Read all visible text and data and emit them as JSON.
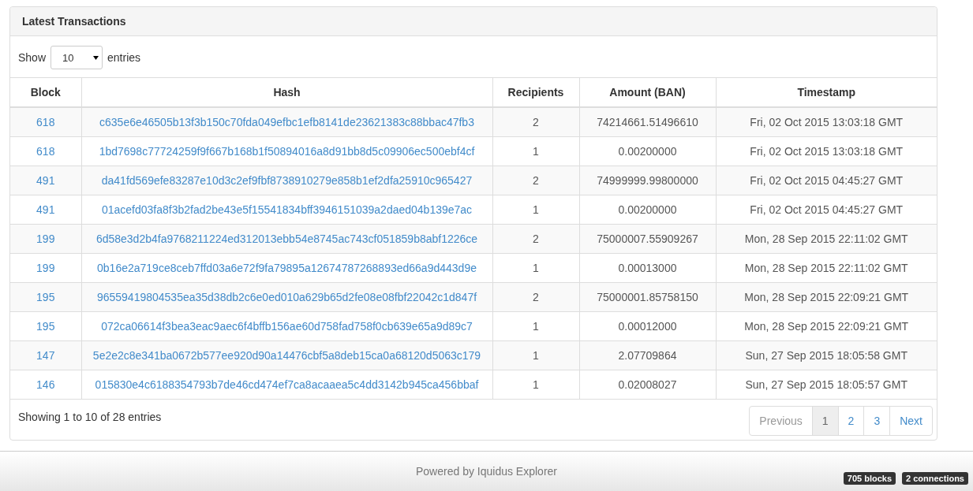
{
  "panel": {
    "title": "Latest Transactions"
  },
  "length_control": {
    "label_before": "Show",
    "value": "10",
    "label_after": "entries"
  },
  "table": {
    "columns": [
      "Block",
      "Hash",
      "Recipients",
      "Amount (BAN)",
      "Timestamp"
    ],
    "rows": [
      {
        "block": "618",
        "hash": "c635e6e46505b13f3b150c70fda049efbc1efb8141de23621383c88bbac47fb3",
        "recipients": "2",
        "amount": "74214661.51496610",
        "timestamp": "Fri, 02 Oct 2015 13:03:18 GMT"
      },
      {
        "block": "618",
        "hash": "1bd7698c77724259f9f667b168b1f50894016a8d91bb8d5c09906ec500ebf4cf",
        "recipients": "1",
        "amount": "0.00200000",
        "timestamp": "Fri, 02 Oct 2015 13:03:18 GMT"
      },
      {
        "block": "491",
        "hash": "da41fd569efe83287e10d3c2ef9fbf8738910279e858b1ef2dfa25910c965427",
        "recipients": "2",
        "amount": "74999999.99800000",
        "timestamp": "Fri, 02 Oct 2015 04:45:27 GMT"
      },
      {
        "block": "491",
        "hash": "01acefd03fa8f3b2fad2be43e5f15541834bff3946151039a2daed04b139e7ac",
        "recipients": "1",
        "amount": "0.00200000",
        "timestamp": "Fri, 02 Oct 2015 04:45:27 GMT"
      },
      {
        "block": "199",
        "hash": "6d58e3d2b4fa9768211224ed312013ebb54e8745ac743cf051859b8abf1226ce",
        "recipients": "2",
        "amount": "75000007.55909267",
        "timestamp": "Mon, 28 Sep 2015 22:11:02 GMT"
      },
      {
        "block": "199",
        "hash": "0b16e2a719ce8ceb7ffd03a6e72f9fa79895a12674787268893ed66a9d443d9e",
        "recipients": "1",
        "amount": "0.00013000",
        "timestamp": "Mon, 28 Sep 2015 22:11:02 GMT"
      },
      {
        "block": "195",
        "hash": "96559419804535ea35d38db2c6e0ed010a629b65d2fe08e08fbf22042c1d847f",
        "recipients": "2",
        "amount": "75000001.85758150",
        "timestamp": "Mon, 28 Sep 2015 22:09:21 GMT"
      },
      {
        "block": "195",
        "hash": "072ca06614f3bea3eac9aec6f4bffb156ae60d758fad758f0cb639e65a9d89c7",
        "recipients": "1",
        "amount": "0.00012000",
        "timestamp": "Mon, 28 Sep 2015 22:09:21 GMT"
      },
      {
        "block": "147",
        "hash": "5e2e2c8e341ba0672b577ee920d90a14476cbf5a8deb15ca0a68120d5063c179",
        "recipients": "1",
        "amount": "2.07709864",
        "timestamp": "Sun, 27 Sep 2015 18:05:58 GMT"
      },
      {
        "block": "146",
        "hash": "015830e4c6188354793b7de46cd474ef7ca8acaaea5c4dd3142b945ca456bbaf",
        "recipients": "1",
        "amount": "0.02008027",
        "timestamp": "Sun, 27 Sep 2015 18:05:57 GMT"
      }
    ]
  },
  "info": "Showing 1 to 10 of 28 entries",
  "pagination": [
    {
      "label": "Previous",
      "selected": false,
      "disabled": true
    },
    {
      "label": "1",
      "selected": true,
      "disabled": false
    },
    {
      "label": "2",
      "selected": false,
      "disabled": false
    },
    {
      "label": "3",
      "selected": false,
      "disabled": false
    },
    {
      "label": "Next",
      "selected": false,
      "disabled": false
    }
  ],
  "footer": {
    "text": "Powered by Iquidus Explorer",
    "badges": [
      "705 blocks",
      "2 connections"
    ]
  }
}
